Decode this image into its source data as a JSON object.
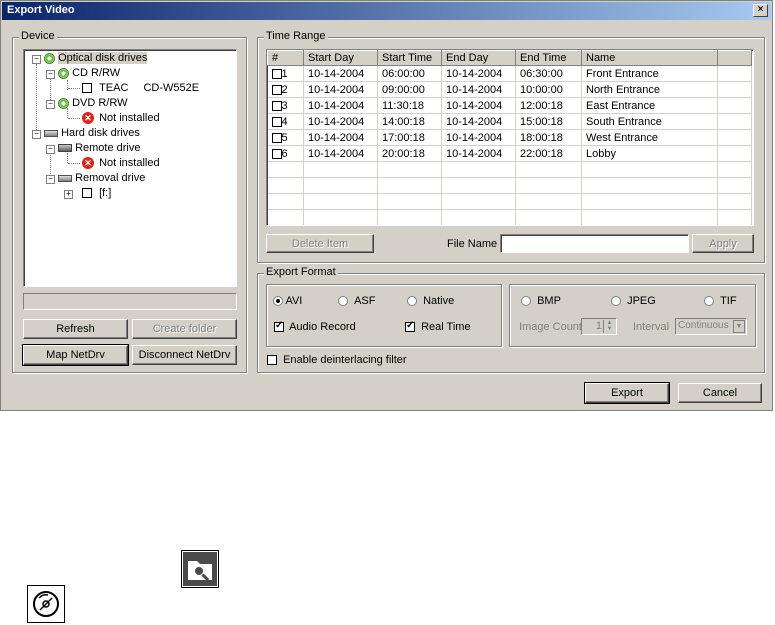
{
  "window": {
    "title": "Export Video",
    "close_glyph": "×"
  },
  "device": {
    "legend": "Device",
    "tree": {
      "optical": "Optical disk drives",
      "cdrw": "CD R/RW",
      "teac": "TEAC",
      "teac_model": "CD-W552E",
      "dvdrw": "DVD R/RW",
      "dvd_status": "Not installed",
      "hard": "Hard disk drives",
      "remote": "Remote drive",
      "remote_status": "Not installed",
      "removal": "Removal drive",
      "removal_child": "[f:]"
    },
    "refresh": "Refresh",
    "create_folder": "Create folder",
    "map_netdrv": "Map NetDrv",
    "disconnect_netdrv": "Disconnect NetDrv"
  },
  "time_range": {
    "legend": "Time Range",
    "columns": [
      "#",
      "Start Day",
      "Start Time",
      "End Day",
      "End Time",
      "Name"
    ],
    "rows": [
      {
        "n": "1",
        "start_day": "10-14-2004",
        "start_time": "06:00:00",
        "end_day": "10-14-2004",
        "end_time": "06:30:00",
        "name": "Front Entrance"
      },
      {
        "n": "2",
        "start_day": "10-14-2004",
        "start_time": "09:00:00",
        "end_day": "10-14-2004",
        "end_time": "10:00:00",
        "name": "North Entrance"
      },
      {
        "n": "3",
        "start_day": "10-14-2004",
        "start_time": "11:30:18",
        "end_day": "10-14-2004",
        "end_time": "12:00:18",
        "name": "East Entrance"
      },
      {
        "n": "4",
        "start_day": "10-14-2004",
        "start_time": "14:00:18",
        "end_day": "10-14-2004",
        "end_time": "15:00:18",
        "name": "South Entrance"
      },
      {
        "n": "5",
        "start_day": "10-14-2004",
        "start_time": "17:00:18",
        "end_day": "10-14-2004",
        "end_time": "18:00:18",
        "name": "West Entrance"
      },
      {
        "n": "6",
        "start_day": "10-14-2004",
        "start_time": "20:00:18",
        "end_day": "10-14-2004",
        "end_time": "22:00:18",
        "name": "Lobby"
      }
    ],
    "delete_item": "Delete Item",
    "file_name_label": "File Name",
    "file_name_value": "",
    "apply": "Apply"
  },
  "export_format": {
    "legend": "Export Format",
    "avi": "AVI",
    "asf": "ASF",
    "native": "Native",
    "audio_record": "Audio Record",
    "real_time": "Real Time",
    "bmp": "BMP",
    "jpeg": "JPEG",
    "tif": "TIF",
    "image_count_label": "Image Count",
    "image_count_value": "1",
    "interval_label": "Interval",
    "interval_value": "Continuous",
    "deinterlace": "Enable deinterlacing filter",
    "selected_video_format": "AVI",
    "audio_record_checked": true,
    "real_time_checked": true,
    "deinterlace_checked": false
  },
  "buttons": {
    "export": "Export",
    "cancel": "Cancel"
  },
  "icons": {
    "folder_search": "folder-search-icon",
    "disc": "disc-icon"
  }
}
